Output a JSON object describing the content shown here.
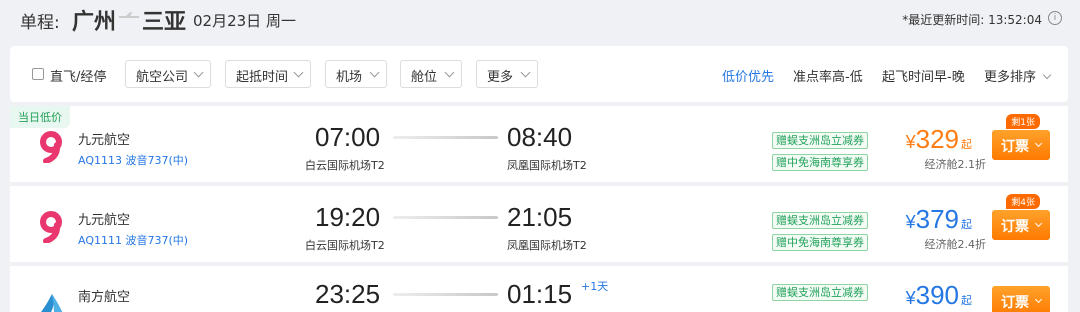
{
  "header": {
    "label": "单程:",
    "from_city": "广州",
    "to_city": "三亚",
    "date": "02月23日 周一",
    "last_update": "*最近更新时间: 13:52:04",
    "info_glyph": "i"
  },
  "filters": {
    "direct_label": "直飞/经停",
    "buttons": [
      "航空公司",
      "起抵时间",
      "机场",
      "舱位",
      "更多"
    ]
  },
  "sorts": [
    "低价优先",
    "准点率高-低",
    "起飞时间早-晚",
    "更多排序"
  ],
  "flights": [
    {
      "tag": "当日低价",
      "airline": "九元航空",
      "flight_info": "AQ1113 波音737(中)",
      "dep_time": "07:00",
      "dep_airport": "白云国际机场T2",
      "arr_time": "08:40",
      "arr_airport": "凤凰国际机场T2",
      "promos": [
        "赠蜈支洲岛立减券",
        "赠中免海南尊享券"
      ],
      "currency": "¥",
      "price": "329",
      "price_suffix": "起",
      "cabin": "经济舱2.1折",
      "remaining": "剩1张",
      "book_label": "订票",
      "price_color": "#ff7d13"
    },
    {
      "airline": "九元航空",
      "flight_info": "AQ1111 波音737(中)",
      "dep_time": "19:20",
      "dep_airport": "白云国际机场T2",
      "arr_time": "21:05",
      "arr_airport": "凤凰国际机场T2",
      "promos": [
        "赠蜈支洲岛立减券",
        "赠中免海南尊享券"
      ],
      "currency": "¥",
      "price": "379",
      "price_suffix": "起",
      "cabin": "经济舱2.4折",
      "remaining": "剩4张",
      "book_label": "订票",
      "price_color": "#2577e3"
    },
    {
      "airline": "南方航空",
      "dep_time": "23:25",
      "arr_time": "01:15",
      "next_day": "+1天",
      "promos": [
        "赠蜈支洲岛立减券"
      ],
      "currency": "¥",
      "price": "390",
      "price_suffix": "起",
      "book_label": "订票",
      "price_color": "#2577e3"
    }
  ],
  "colors": {
    "accent_blue": "#2577e3",
    "accent_orange": "#ff7d13",
    "promo_green": "#22a25a",
    "jiuyuan_logo": "#e8386d",
    "csair_logo": "#2a8fd0"
  },
  "icons": {
    "route_separator": "plane-icon",
    "jiuyuan_logo": "jiuyuan-airlines-logo",
    "csair_logo": "china-southern-logo"
  }
}
